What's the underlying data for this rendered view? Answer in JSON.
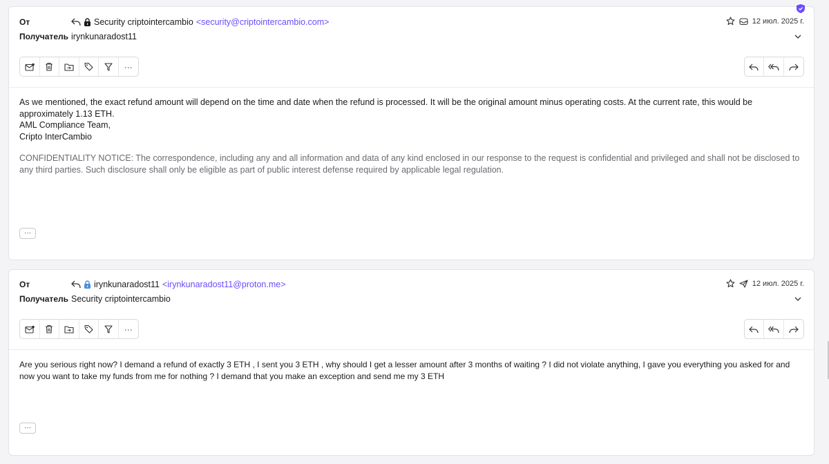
{
  "messages": [
    {
      "from_label": "От",
      "to_label": "Получатель",
      "sender_name": "Security criptointercambio",
      "sender_address": "<security@criptointercambio.com>",
      "recipient": "irynkunaradost11",
      "date": "12 июл. 2025 г.",
      "paragraph_1": "As we mentioned, the exact refund amount will depend on the time and date when the refund is processed. It will be the original amount minus operating costs. At the current rate, this would be approximately 1.13 ETH.",
      "signature_line_1": "AML Compliance Team,",
      "signature_line_2": "Cripto InterCambio",
      "notice": "CONFIDENTIALITY NOTICE: The correspondence, including any and all information and data of any kind enclosed in our response to the request is confidential and privileged and shall not be disclosed to any third parties. Such disclosure shall only be eligible as part of public interest defense required by applicable legal regulation.",
      "more_label": "···"
    },
    {
      "from_label": "От",
      "to_label": "Получатель",
      "sender_name": "irynkunaradost11",
      "sender_address": "<irynkunaradost11@proton.me>",
      "recipient": "Security criptointercambio",
      "date": "12 июл. 2025 г.",
      "body": "Are you serious right now? I demand a refund of exactly 3 ETH , I sent you 3 ETH , why should I get a lesser amount after 3 months of waiting ? I did not violate anything, I gave you everything you asked for and now you want to take my funds from me for nothing ?  I demand that you make an exception and send me my 3 ETH",
      "more_label": "···"
    }
  ],
  "toolbar_more_label": "···",
  "colors": {
    "accent": "#6d4aff",
    "border": "#e3e3e8",
    "muted": "#6a6a72"
  }
}
